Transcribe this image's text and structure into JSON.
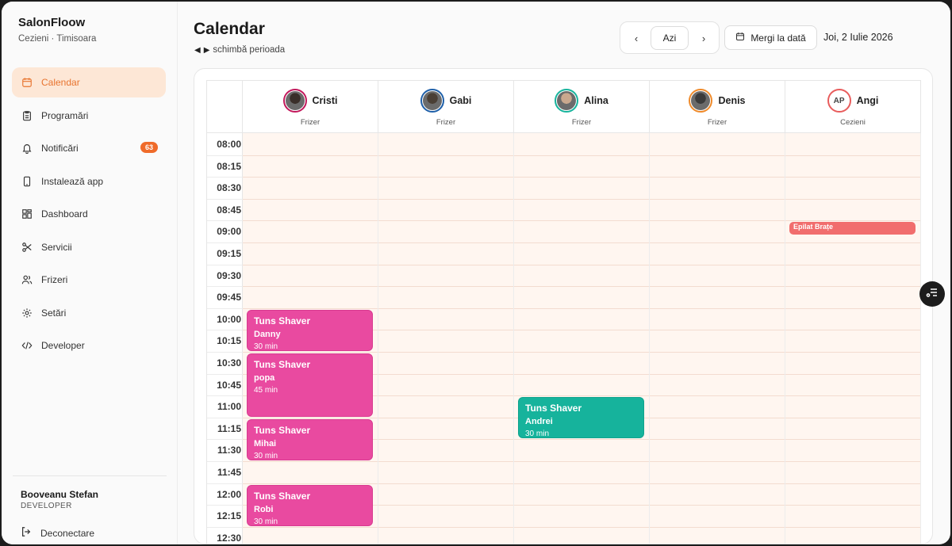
{
  "sidebar": {
    "brand": "SalonFloow",
    "subtitle": "Cezieni · Timisoara",
    "items": [
      {
        "label": "Calendar",
        "icon": "calendar-icon",
        "active": true
      },
      {
        "label": "Programări",
        "icon": "clipboard-icon"
      },
      {
        "label": "Notificări",
        "icon": "bell-icon",
        "badge": "63"
      },
      {
        "label": "Instalează app",
        "icon": "phone-icon"
      },
      {
        "label": "Dashboard",
        "icon": "grid-icon"
      },
      {
        "label": "Servicii",
        "icon": "scissors-icon"
      },
      {
        "label": "Frizeri",
        "icon": "users-icon"
      },
      {
        "label": "Setări",
        "icon": "gear-icon"
      },
      {
        "label": "Developer",
        "icon": "code-icon"
      }
    ],
    "user": {
      "name": "Booveanu Stefan",
      "role": "DEVELOPER"
    },
    "logout_label": "Deconectare"
  },
  "header": {
    "title": "Calendar",
    "period_hint": "schimbă perioada",
    "today_label": "Azi",
    "goto_label": "Mergi la dată",
    "current_date": "Joi, 2 Iulie 2026"
  },
  "colors": {
    "accent": "#e8742f",
    "badge": "#ef6b2a",
    "appt_pink": "#e94aa0",
    "appt_teal": "#16b39c",
    "appt_red": "#f16d6d",
    "slot_bg": "#fff6f0"
  },
  "calendar": {
    "times": [
      "08:00",
      "08:15",
      "08:30",
      "08:45",
      "09:00",
      "09:15",
      "09:30",
      "09:45",
      "10:00",
      "10:15",
      "10:30",
      "10:45",
      "11:00",
      "11:15",
      "11:30",
      "11:45",
      "12:00",
      "12:15",
      "12:30"
    ],
    "staff": [
      {
        "name": "Cristi",
        "role": "Frizer",
        "ring": "#c2185b",
        "face": "#3a2f2a"
      },
      {
        "name": "Gabi",
        "role": "Frizer",
        "ring": "#1e5fa8",
        "face": "#4a3f35"
      },
      {
        "name": "Alina",
        "role": "Frizer",
        "ring": "#16b39c",
        "face": "#c9a88e"
      },
      {
        "name": "Denis",
        "role": "Frizer",
        "ring": "#ef8a2a",
        "face": "#3b3b3b"
      },
      {
        "name": "Angi",
        "role": "Cezieni",
        "ring": "#e85c5c",
        "initials": "AP"
      }
    ],
    "appointments": [
      {
        "staff": 0,
        "start": "10:00",
        "slots": 2,
        "service": "Tuns Shaver",
        "client": "Danny",
        "duration": "30 min",
        "color": "pink"
      },
      {
        "staff": 0,
        "start": "10:30",
        "slots": 3,
        "service": "Tuns Shaver",
        "client": "popa",
        "duration": "45 min",
        "color": "pink"
      },
      {
        "staff": 0,
        "start": "11:15",
        "slots": 2,
        "service": "Tuns Shaver",
        "client": "Mihai",
        "duration": "30 min",
        "color": "pink"
      },
      {
        "staff": 0,
        "start": "12:00",
        "slots": 2,
        "service": "Tuns Shaver",
        "client": "Robi",
        "duration": "30 min",
        "color": "pink"
      },
      {
        "staff": 2,
        "start": "11:00",
        "slots": 2,
        "service": "Tuns Shaver",
        "client": "Andrei",
        "duration": "30 min",
        "color": "teal"
      },
      {
        "staff": 4,
        "start": "09:00",
        "slots": 0.6,
        "service": "Epilat Brațe",
        "color": "red"
      }
    ]
  }
}
